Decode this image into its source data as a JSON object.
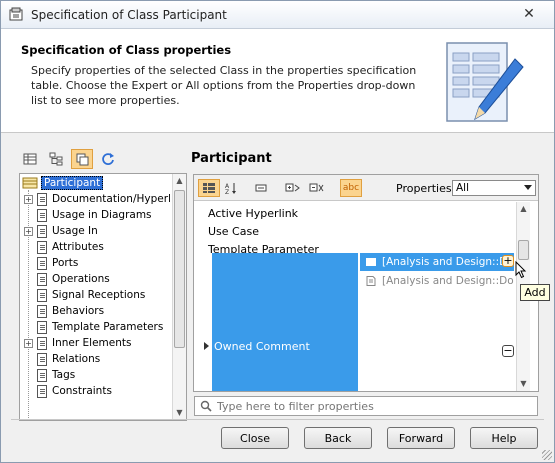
{
  "window": {
    "title": "Specification of Class Participant",
    "close_glyph": "✕"
  },
  "header": {
    "title": "Specification of Class properties",
    "description": "Specify properties of the selected Class in the properties specification table. Choose the Expert or All options from the Properties drop-down list to see more properties."
  },
  "left": {
    "toolbar": [
      {
        "name": "list-view-icon",
        "active": false
      },
      {
        "name": "tree-view-icon",
        "active": false
      },
      {
        "name": "compact-view-icon",
        "active": true
      },
      {
        "name": "refresh-icon",
        "active": false
      }
    ],
    "tree": {
      "root": "Participant",
      "items": [
        {
          "label": "Documentation/Hyperlinks",
          "expandable": true
        },
        {
          "label": "Usage in Diagrams",
          "expandable": false
        },
        {
          "label": "Usage In",
          "expandable": true
        },
        {
          "label": "Attributes",
          "expandable": false
        },
        {
          "label": "Ports",
          "expandable": false
        },
        {
          "label": "Operations",
          "expandable": false
        },
        {
          "label": "Signal Receptions",
          "expandable": false
        },
        {
          "label": "Behaviors",
          "expandable": false
        },
        {
          "label": "Template Parameters",
          "expandable": false
        },
        {
          "label": "Inner Elements",
          "expandable": true
        },
        {
          "label": "Relations",
          "expandable": false
        },
        {
          "label": "Tags",
          "expandable": false
        },
        {
          "label": "Constraints",
          "expandable": false
        }
      ]
    }
  },
  "right": {
    "title": "Participant",
    "properties_label": "Properties:",
    "properties_value": "All",
    "rows": [
      "Active Hyperlink",
      "Use Case",
      "Template Parameter"
    ],
    "owned_comment": {
      "label": "Owned Comment",
      "values": [
        {
          "text": "[Analysis and Design::Do",
          "selected": true
        },
        {
          "text": "[Analysis and Design::Do",
          "selected": false
        }
      ]
    },
    "add_tooltip": "Add",
    "add_glyph": "+",
    "remove_glyph": "−",
    "abc_label": "abc",
    "filter_placeholder": "Type here to filter properties"
  },
  "buttons": {
    "close": "Close",
    "back": "Back",
    "forward": "Forward",
    "help": "Help"
  }
}
